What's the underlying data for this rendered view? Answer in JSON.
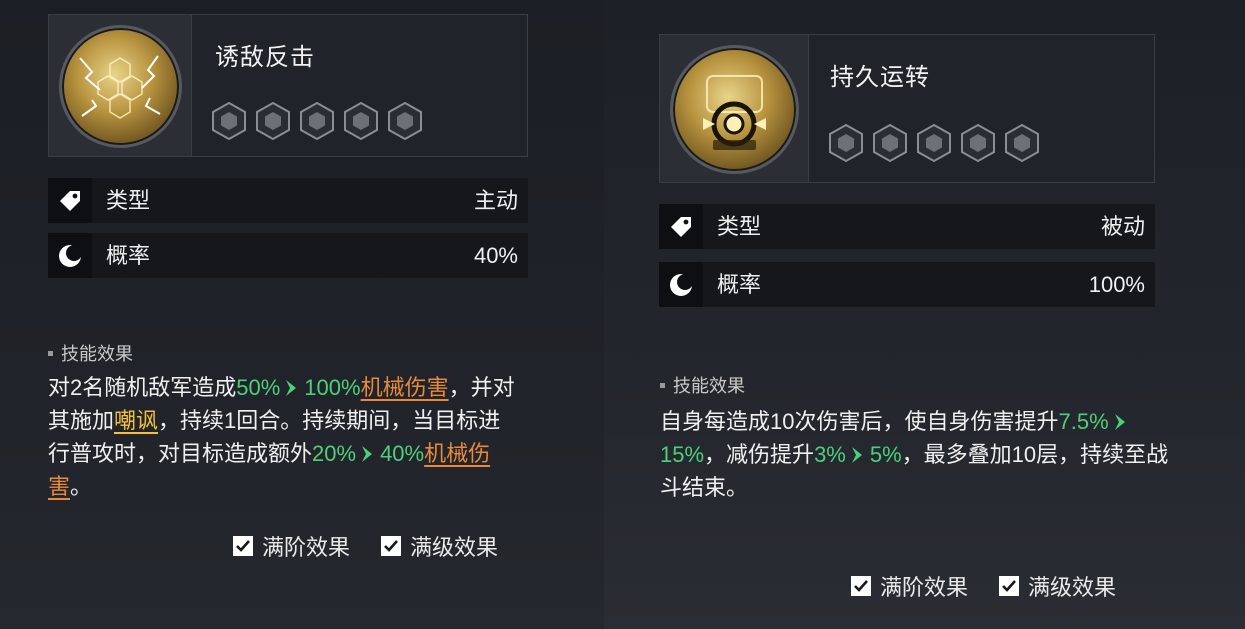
{
  "left_skill": {
    "name": "诱敌反击",
    "stars_total": 5,
    "stars_filled": 0,
    "type_label": "类型",
    "type_value": "主动",
    "rate_label": "概率",
    "rate_value": "40%",
    "effect_title": "技能效果",
    "desc": {
      "p1": "对2名随机敌军造成",
      "v1a": "50%",
      "v1b": "100%",
      "dmg1": "机械伤害",
      "p2": "，并对其施加",
      "taunt": "嘲讽",
      "p3": "，持续1回合。持续期间，当目标进行普攻时，对目标造成额外",
      "v2a": "20%",
      "v2b": "40%",
      "dmg2": "机械伤害",
      "p4": "。"
    },
    "check_full_stage": "满阶效果",
    "check_full_level": "满级效果"
  },
  "right_skill": {
    "name": "持久运转",
    "stars_total": 5,
    "stars_filled": 0,
    "type_label": "类型",
    "type_value": "被动",
    "rate_label": "概率",
    "rate_value": "100%",
    "effect_title": "技能效果",
    "desc": {
      "p1": "自身每造成10次伤害后，使自身伤害提升",
      "v1a": "7.5%",
      "v1b": "15%",
      "p2": "，减伤提升",
      "v2a": "3%",
      "v2b": "5%",
      "p3": "，最多叠加10层，持续至战斗结束。"
    },
    "check_full_stage": "满阶效果",
    "check_full_level": "满级效果"
  },
  "colors": {
    "highlight_green": "#4cd07a",
    "damage_orange": "#e88a3c",
    "status_yellow": "#f3c23a"
  }
}
